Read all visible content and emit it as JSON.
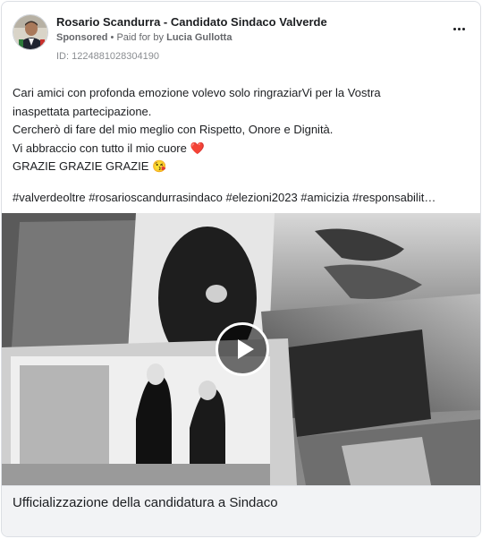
{
  "post": {
    "page_name": "Rosario Scandurra - Candidato Sindaco Valverde",
    "sponsored_label": "Sponsored",
    "separator": "•",
    "paid_for_prefix": "Paid for by",
    "payer": "Lucia Gullotta",
    "ad_id": "ID: 1224881028304190",
    "more_icon": "more-horizontal-icon",
    "body_lines": [
      "Cari amici con profonda emozione volevo solo ringraziarVi per la Vostra",
      "inaspettata partecipazione.",
      "Cercherò di fare del mio meglio con Rispetto, Onore e Dignità.",
      "Vi abbraccio con tutto il mio cuore",
      "GRAZIE GRAZIE GRAZIE"
    ],
    "heart_emoji": "❤️",
    "kiss_emoji": "😘",
    "hashtags": "#valverdeoltre #rosarioscandurrasindaco #elezioni2023 #amicizia #responsabilit…",
    "media_caption": "Ufficializzazione della candidatura a Sindaco",
    "play_icon": "play-icon"
  },
  "colors": {
    "text_primary": "#1c1e21",
    "text_secondary": "#65676b",
    "heart": "#e41e3f",
    "caption_bg": "#f2f3f5"
  }
}
